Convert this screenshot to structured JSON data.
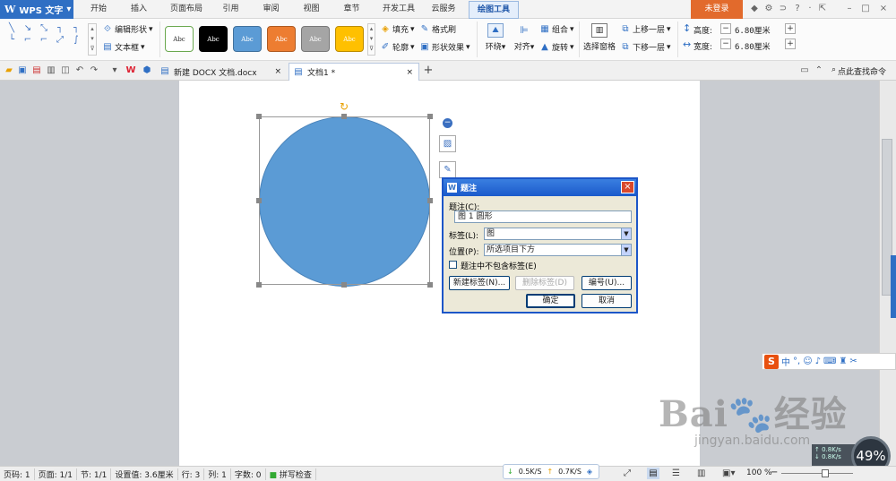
{
  "app": {
    "logo_letter": "W",
    "name": "WPS 文字",
    "dropdown": "▾"
  },
  "menu": [
    "开始",
    "插入",
    "页面布局",
    "引用",
    "审阅",
    "视图",
    "章节",
    "开发工具",
    "云服务",
    "绘图工具"
  ],
  "login_label": "未登录",
  "ribbon": {
    "edit_shape": "编辑形状",
    "text_box": "文本框",
    "style_text": "Abc",
    "fill": "填充",
    "format_painter": "格式刷",
    "outline": "轮廓",
    "shape_effect": "形状效果",
    "wrap": "环绕",
    "align": "对齐",
    "group": "组合",
    "rotate": "旋转",
    "selection_pane": "选择窗格",
    "bring_forward": "上移一层",
    "send_backward": "下移一层",
    "height_label": "高度:",
    "height_value": "6.80厘米",
    "width_label": "宽度:",
    "width_value": "6.80厘米",
    "minus": "−",
    "plus": "+"
  },
  "tabs": {
    "doc1": "新建 DOCX 文档.docx",
    "doc2": "文档1 *",
    "close": "×",
    "add": "+",
    "find_command": "点此查找命令"
  },
  "dialog": {
    "title": "题注",
    "caption_label": "题注(C):",
    "caption_value": "图 1  圆形",
    "label_label": "标签(L):",
    "label_value": "图",
    "position_label": "位置(P):",
    "position_value": "所选项目下方",
    "exclude_label": "题注中不包含标签(E)",
    "new_label_btn": "新建标签(N)...",
    "delete_label_btn": "删除标签(D)",
    "numbering_btn": "编号(U)...",
    "ok_btn": "确定",
    "cancel_btn": "取消"
  },
  "ime": {
    "brand": "S",
    "lang": "中"
  },
  "watermark": {
    "brand": "Bai",
    "cn": "经验",
    "url": "jingyan.baidu.com"
  },
  "net": {
    "percent": "49%",
    "up": "0.8K/s",
    "down": "0.8K/s"
  },
  "status": {
    "page_num": "页码: 1",
    "pages": "页面: 1/1",
    "section": "节: 1/1",
    "setting": "设置值: 3.6厘米",
    "row": "行: 3",
    "col": "列: 1",
    "words": "字数: 0",
    "spell": "拼写检查",
    "zoom": "100 %",
    "down_speed": "0.5K/S",
    "up_speed": "0.7K/S"
  },
  "colors": {
    "accent": "#2f6fc4",
    "shape_fill": "#5b9bd5",
    "login": "#e26a2c"
  }
}
